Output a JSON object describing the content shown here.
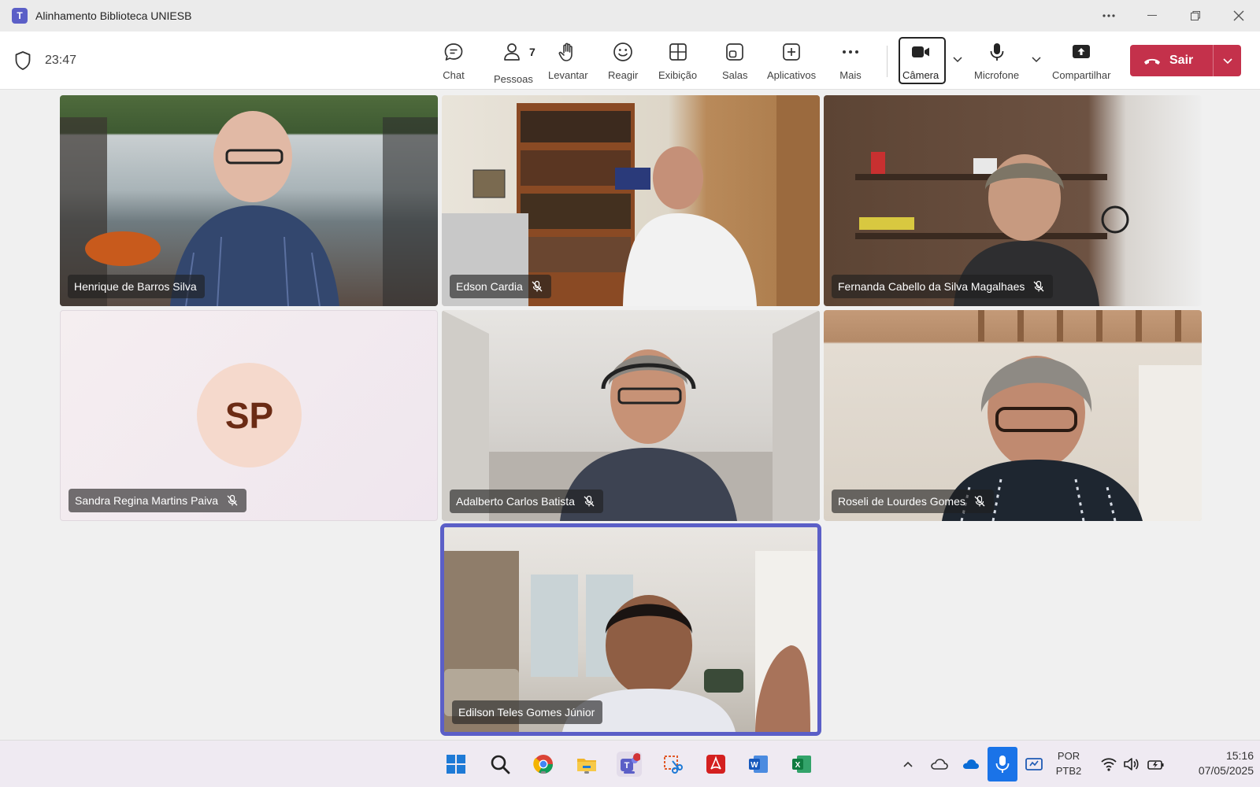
{
  "window": {
    "title": "Alinhamento Biblioteca UNIESB",
    "app_icon": "teams-icon"
  },
  "toolbar": {
    "timer": "23:47",
    "chat_label": "Chat",
    "people_label": "Pessoas",
    "people_count": "7",
    "raise_label": "Levantar",
    "react_label": "Reagir",
    "view_label": "Exibição",
    "rooms_label": "Salas",
    "apps_label": "Aplicativos",
    "more_label": "Mais",
    "camera_label": "Câmera",
    "mic_label": "Microfone",
    "share_label": "Compartilhar",
    "leave_label": "Sair",
    "leave_color": "#c4314b"
  },
  "participants": [
    {
      "name": "Henrique de Barros Silva",
      "muted": false
    },
    {
      "name": "Edson Cardia",
      "muted": true
    },
    {
      "name": "Fernanda Cabello da Silva Magalhaes",
      "muted": true
    },
    {
      "name": "Sandra Regina Martins Paiva",
      "muted": true,
      "initials": "SP",
      "avatar_color": "#f5d9cc",
      "initials_color": "#6b2b14"
    },
    {
      "name": "Adalberto Carlos Batista",
      "muted": true
    },
    {
      "name": "Roseli de Lourdes Gomes",
      "muted": true
    },
    {
      "name": "Edilson Teles Gomes Júnior",
      "muted": false,
      "active_speaker": true
    }
  ],
  "accent_color": "#5b5fc7",
  "taskbar": {
    "apps": [
      "windows-start-icon",
      "search-icon",
      "chrome-icon",
      "file-explorer-icon",
      "teams-icon",
      "snipping-tool-icon",
      "acrobat-icon",
      "word-icon",
      "excel-icon"
    ],
    "language_line1": "POR",
    "language_line2": "PTB2",
    "time": "15:16",
    "date": "07/05/2025"
  }
}
